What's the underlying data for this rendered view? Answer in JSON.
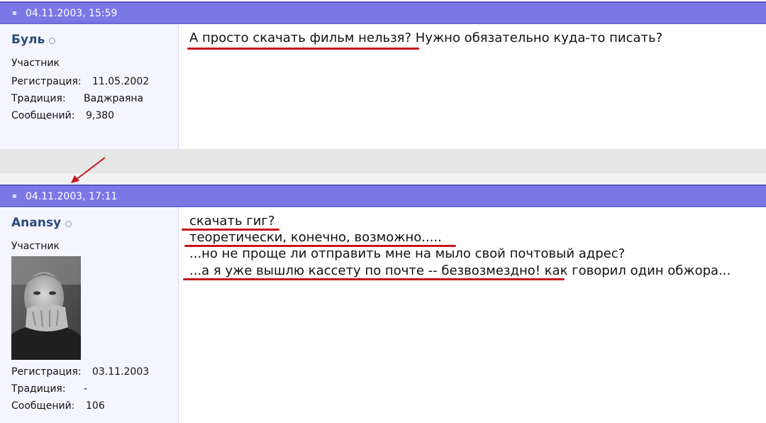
{
  "posts": [
    {
      "date": "04.11.2003, 15:59",
      "username": "Буль",
      "rank": "Участник",
      "reg_label": "Регистрация:",
      "reg_value": "11.05.2002",
      "trad_label": "Традиция:",
      "trad_value": "Ваджраяна",
      "msgs_label": "Сообщений:",
      "msgs_value": "9,380",
      "lines": [
        "А просто скачать фильм нельзя? Нужно обязательно куда-то писать?"
      ]
    },
    {
      "date": "04.11.2003, 17:11",
      "username": "Anansy",
      "rank": "Участник",
      "reg_label": "Регистрация:",
      "reg_value": "03.11.2003",
      "trad_label": "Традиция:",
      "trad_value": "-",
      "msgs_label": "Сообщений:",
      "msgs_value": "106",
      "lines": [
        "скачать гиг?",
        "теоретически, конечно, возможно.....",
        "...но не проще ли отправить мне на мыло свой почтовый адрес?",
        "...а я уже вышлю кассету по почте -- безвозмездно! как говорил один обжора..."
      ]
    }
  ],
  "colors": {
    "header": "#7b78e6",
    "underline": "#c8151b",
    "username": "#2a4a7a"
  },
  "icons": [
    "post-bullet-icon",
    "online-status-icon",
    "red-arrow-annotation",
    "avatar-photo"
  ]
}
